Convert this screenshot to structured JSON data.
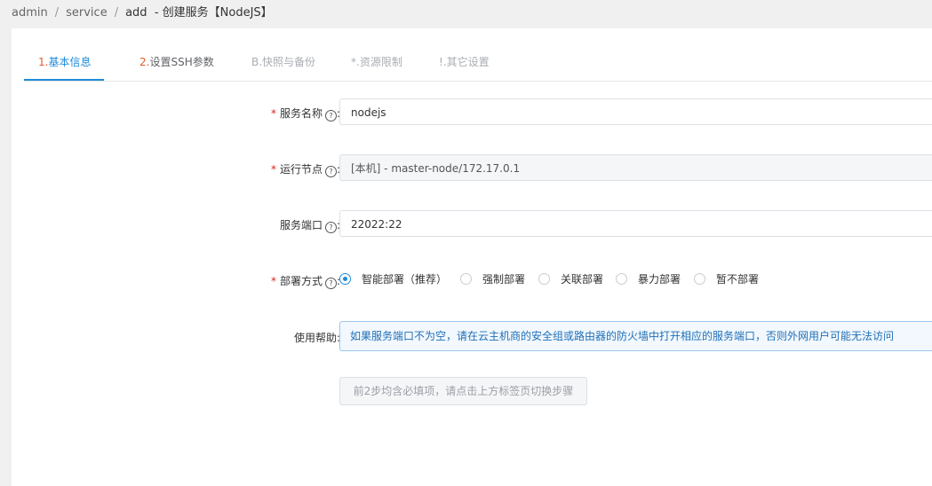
{
  "breadcrumb": {
    "items": [
      "admin",
      "service",
      "add"
    ],
    "separator": "/",
    "title": "-  创建服务【NodeJS】"
  },
  "tabs": [
    {
      "num": "1.",
      "label": "基本信息",
      "state": "active"
    },
    {
      "num": "2.",
      "label": "设置SSH参数",
      "state": "normal"
    },
    {
      "num": "",
      "label": "B.快照与备份",
      "state": "disabled"
    },
    {
      "num": "",
      "label": "*.资源限制",
      "state": "disabled"
    },
    {
      "num": "",
      "label": "!.其它设置",
      "state": "disabled"
    }
  ],
  "form": {
    "service_name": {
      "required": true,
      "label": "服务名称",
      "value": "nodejs"
    },
    "run_node": {
      "required": true,
      "label": "运行节点",
      "value": "[本机] - master-node/172.17.0.1"
    },
    "service_port": {
      "required": false,
      "label": "服务端口",
      "value": "22022:22"
    },
    "deploy_mode": {
      "required": true,
      "label": "部署方式",
      "selected": "智能部署（推荐）",
      "options": [
        "智能部署（推荐）",
        "强制部署",
        "关联部署",
        "暴力部署",
        "暂不部署"
      ]
    },
    "usage_help": {
      "label": "使用帮助:",
      "text": "如果服务端口不为空，请在云主机商的安全组或路由器的防火墙中打开相应的服务端口，否则外网用户可能无法访问"
    },
    "submit_hint": "前2步均含必填项，请点击上方标签页切换步骤"
  },
  "colors": {
    "accent": "#1f8bd9",
    "required": "#e02020",
    "step_number": "#e25c2a"
  }
}
